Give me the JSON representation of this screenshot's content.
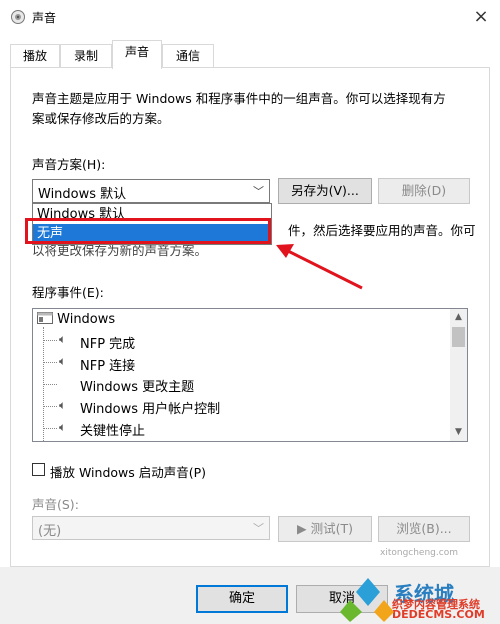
{
  "window": {
    "title": "声音",
    "close": "×"
  },
  "tabs": [
    {
      "label": "播放"
    },
    {
      "label": "录制"
    },
    {
      "label": "声音"
    },
    {
      "label": "通信"
    }
  ],
  "intro_text": [
    "声音主题是应用于 Windows 和程序事件中的一组声音。你可以选择现有方",
    "案或保存修改后的方案。"
  ],
  "scheme": {
    "label": "声音方案(H):",
    "selected": "Windows 默认",
    "save_as": "另存为(V)...",
    "delete": "删除(D)",
    "options": [
      "Windows 默认",
      "无声"
    ],
    "highlighted_option": "无声"
  },
  "hidden_text": {
    "line1_tail": "件，然后选择要应用的声音。你可",
    "line2": "以将更改保存为新的声音方案。"
  },
  "events": {
    "label": "程序事件(E):",
    "root": "Windows",
    "items": [
      "NFP 完成",
      "NFP 连接",
      "Windows 更改主题",
      "Windows 用户帐户控制",
      "关键性停止"
    ]
  },
  "startup": {
    "label": "播放 Windows 启动声音(P)"
  },
  "sound": {
    "label": "声音(S):",
    "value": "(无)",
    "test": "▶ 测试(T)",
    "browse": "浏览(B)..."
  },
  "footer": {
    "ok": "确定",
    "cancel": "取消"
  },
  "watermark": {
    "brand": "系统城",
    "line1": "织梦内容管理系统",
    "line2": "DEDECMS.COM",
    "small": "xitongcheng.com"
  },
  "colors": {
    "highlight": "#1e78d7",
    "annotation": "#e1141e",
    "focus": "#0078d7"
  }
}
